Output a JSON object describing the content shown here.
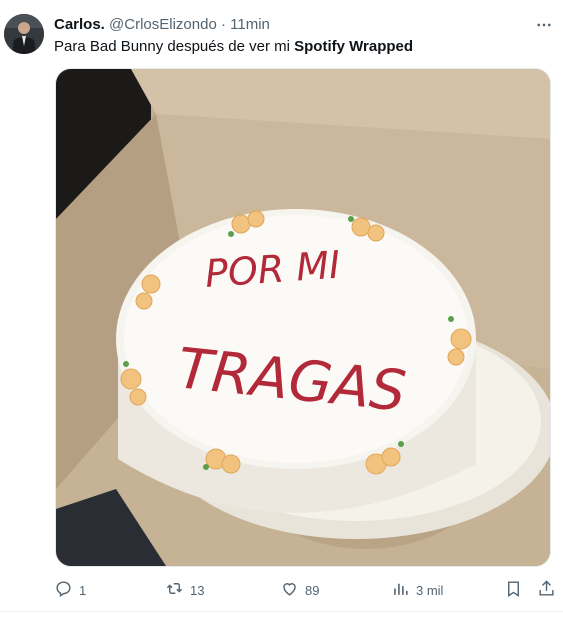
{
  "tweet": {
    "author_name": "Carlos.",
    "author_handle": "@CrlosElizondo",
    "separator": "·",
    "time": "11min",
    "text_before": "Para Bad Bunny después de ver mi ",
    "text_bold": "Spotify Wrapped"
  },
  "media": {
    "cake_text_line1": "POR MI",
    "cake_text_line2": "TRAGAS",
    "icon_colors": {
      "frosting": "#b22a3a",
      "icing": "#f3f1ec",
      "box": "#c8b393"
    }
  },
  "actions": {
    "reply_count": "1",
    "retweet_count": "13",
    "like_count": "89",
    "views_count": "3 mil"
  },
  "icons": [
    "more-icon",
    "reply-icon",
    "retweet-icon",
    "like-icon",
    "views-icon",
    "bookmark-icon",
    "share-icon"
  ]
}
